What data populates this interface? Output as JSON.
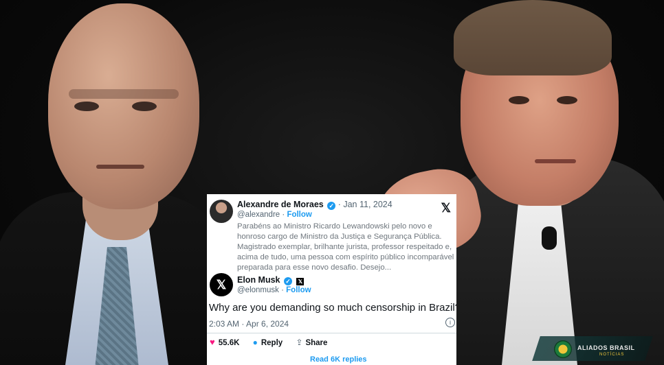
{
  "tweet_reply": {
    "author_name": "Alexandre de Moraes",
    "verified_glyph": "✓",
    "date": "· Jan 11, 2024",
    "handle": "@alexandre",
    "follow_label": "Follow",
    "separator": "·",
    "platform_logo": "𝕏",
    "text": "Parabéns ao Ministro Ricardo Lewandowski pelo novo e honroso cargo de Ministro da Justiça e Segurança Pública. Magistrado exemplar, brilhante jurista, professor respeitado e, acima de tudo, uma pessoa com espírito público incomparável e preparada para esse novo desafio. Desejo..."
  },
  "tweet_main": {
    "author_name": "Elon Musk",
    "x_badge": "𝕏",
    "handle": "@elonmusk",
    "follow_label": "Follow",
    "text": "Why are you demanding so much censorship in Brazil?",
    "timestamp": "2:03 AM · Apr 6, 2024",
    "info_glyph": "i",
    "likes": "55.6K",
    "reply_label": "Reply",
    "share_label": "Share",
    "read_replies": "Read 6K replies"
  },
  "watermark": {
    "brand": "ALIADOS BRASIL",
    "sub": "NOTÍCIAS"
  },
  "icons": {
    "heart": "heart-icon",
    "reply": "reply-icon",
    "share": "share-icon",
    "verified": "verified-badge-icon",
    "x": "x-logo-icon"
  }
}
